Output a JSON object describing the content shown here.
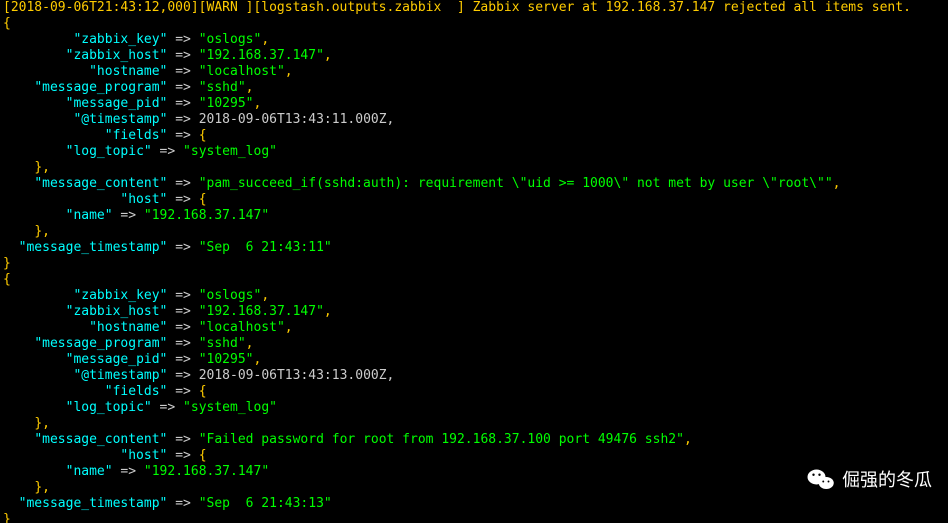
{
  "top_partial_line": "[2018-09-06T21:43:12,000][WARN ][logstash.outputs.zabbix  ] Zabbix server at 192.168.37.147 rejected all items sent. ",
  "entry1": {
    "zabbix_key": "oslogs",
    "zabbix_host": "192.168.37.147",
    "hostname": "localhost",
    "message_program": "sshd",
    "message_pid": "10295",
    "timestamp": "2018-09-06T13:43:11.000Z",
    "log_topic": "system_log",
    "message_content": "pam_succeed_if(sshd:auth): requirement \\\"uid >= 1000\\\" not met by user \\\"root\\\"",
    "host_name": "192.168.37.147",
    "message_timestamp": "Sep  6 21:43:11"
  },
  "entry2": {
    "zabbix_key": "oslogs",
    "zabbix_host": "192.168.37.147",
    "hostname": "localhost",
    "message_program": "sshd",
    "message_pid": "10295",
    "timestamp": "2018-09-06T13:43:13.000Z",
    "log_topic": "system_log",
    "message_content": "Failed password for root from 192.168.37.100 port 49476 ssh2",
    "host_name": "192.168.37.147",
    "message_timestamp": "Sep  6 21:43:13"
  },
  "labels": {
    "zabbix_key": "zabbix_key",
    "zabbix_host": "zabbix_host",
    "hostname": "hostname",
    "message_program": "message_program",
    "message_pid": "message_pid",
    "timestamp": "@timestamp",
    "fields": "fields",
    "log_topic": "log_topic",
    "message_content": "message_content",
    "host": "host",
    "name": "name",
    "message_timestamp": "message_timestamp"
  },
  "arrow": " => ",
  "arrow2": " => ",
  "watermark_text": "倔强的冬瓜"
}
